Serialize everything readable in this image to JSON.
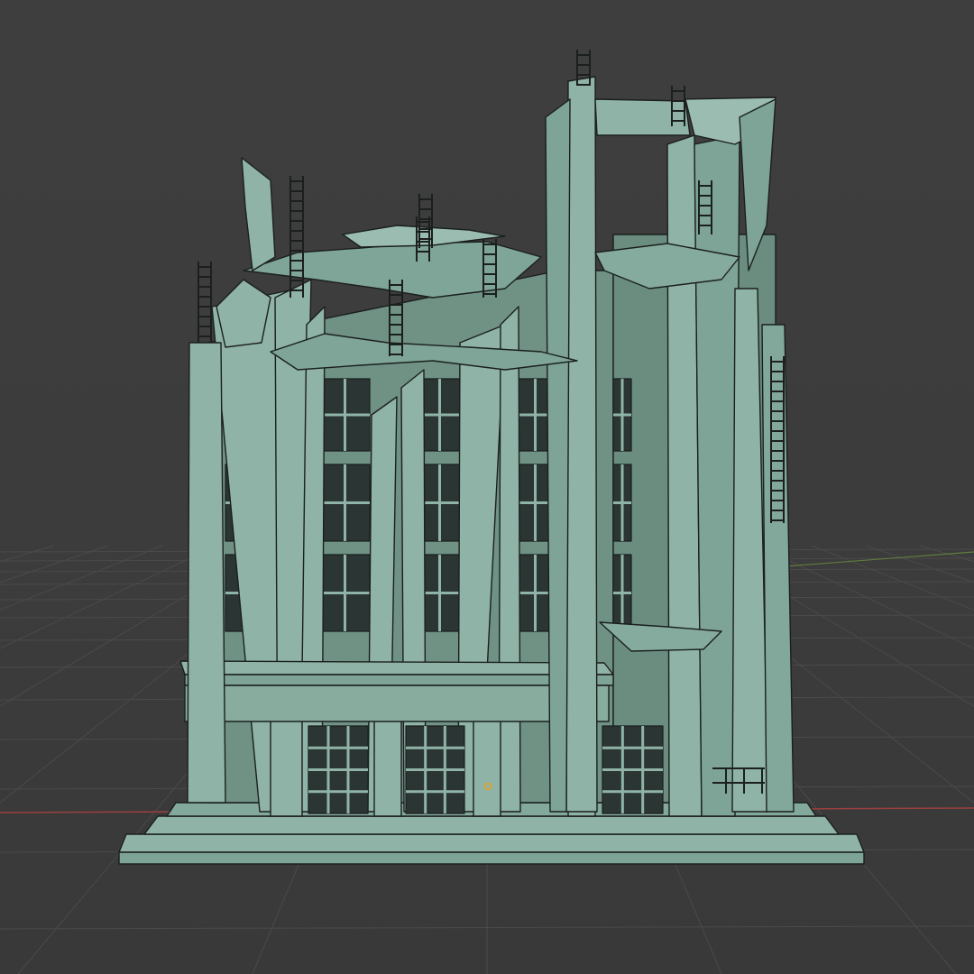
{
  "viewport": {
    "mode": "3d-viewport",
    "background_color": "#3d3d3d",
    "grid_color": "#4a4a4a",
    "x_axis_color": "#9a3f3f",
    "y_axis_color": "#5e7d3c",
    "model_color": "#8fb3a6",
    "model_shadow_color": "#6f9285",
    "edge_color": "#1b1f1e",
    "origin_color": "#e7a21f",
    "model_icon": "ruined-building-mesh",
    "origin_icon": "object-origin-dot"
  }
}
